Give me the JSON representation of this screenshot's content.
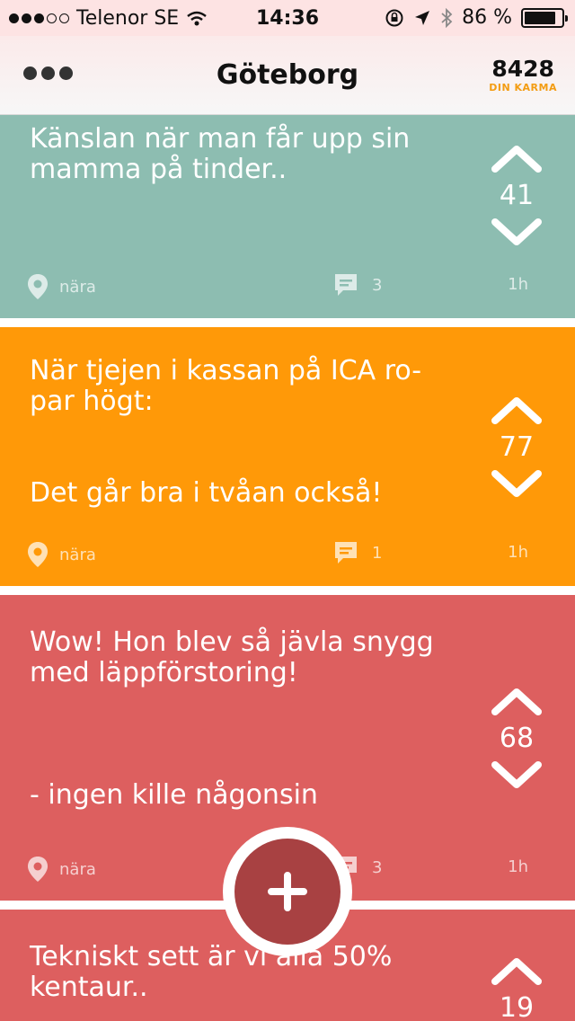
{
  "status_bar": {
    "carrier": "Telenor SE",
    "time": "14:36",
    "battery_text": "86 %",
    "battery_level": 0.86,
    "icons": [
      "wifi-icon",
      "rotation-lock-icon",
      "location-arrow-icon",
      "bluetooth-icon",
      "battery-icon"
    ]
  },
  "header": {
    "title": "Göteborg",
    "karma_value": "8428",
    "karma_label": "DIN KARMA",
    "menu_icon": "more-dots-icon"
  },
  "posts": [
    {
      "text": "Känslan när man får upp sin\nmamma på tinder..",
      "votes": "41",
      "location": "nära",
      "comments": "3",
      "age": "1h",
      "color": "#8dbdb1"
    },
    {
      "text": "När tjejen i kassan på ICA ro-\npar högt:\n\n\nDet går bra i tvåan också!",
      "votes": "77",
      "location": "nära",
      "comments": "1",
      "age": "1h",
      "color": "#ff9908"
    },
    {
      "text": "Wow! Hon blev så jävla snygg\nmed läppförstoring!\n\n\n\n- ingen kille någonsin",
      "votes": "68",
      "location": "nära",
      "comments": "3",
      "age": "1h",
      "color": "#dd5f5f"
    },
    {
      "text": "Tekniskt sett är vi alla 50%\nkentaur..",
      "votes": "19",
      "color": "#dd5f5f"
    }
  ],
  "fab": {
    "icon": "plus-icon",
    "color": "#a84142"
  },
  "colors": {
    "status_bar_bg": "#fde3e3",
    "karma_accent": "#f39c12"
  }
}
